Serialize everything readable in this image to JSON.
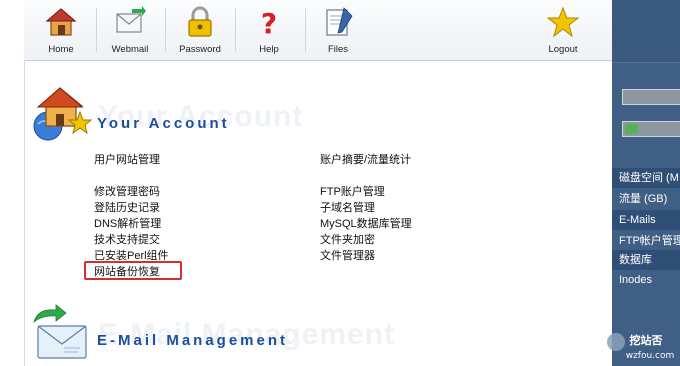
{
  "toolbar": {
    "home": "Home",
    "webmail": "Webmail",
    "password": "Password",
    "help": "Help",
    "files": "Files",
    "logout": "Logout"
  },
  "account": {
    "title": "Your Account",
    "col1": [
      "用户网站管理",
      "修改管理密码",
      "登陆历史记录",
      "DNS解析管理",
      "技术支持提交",
      "已安装Perl组件",
      "网站备份恢复"
    ],
    "col2": [
      "账户摘要/流量统计",
      "FTP账户管理",
      "子域名管理",
      "MySQL数据库管理",
      "文件夹加密",
      "文件管理器"
    ]
  },
  "email": {
    "title": "E-Mail Management"
  },
  "sidebar": {
    "items": [
      "磁盘空间 (M",
      "流量 (GB)",
      "E-Mails",
      "FTP帐户管理",
      "数据库",
      "Inodes"
    ]
  },
  "watermark": {
    "line1": "挖站否",
    "line2": "wzfou.com"
  },
  "colors": {
    "sidebar_bg": "#3f5f84",
    "title_blue": "#1a4fa0",
    "highlight_red": "#d32f2f"
  }
}
